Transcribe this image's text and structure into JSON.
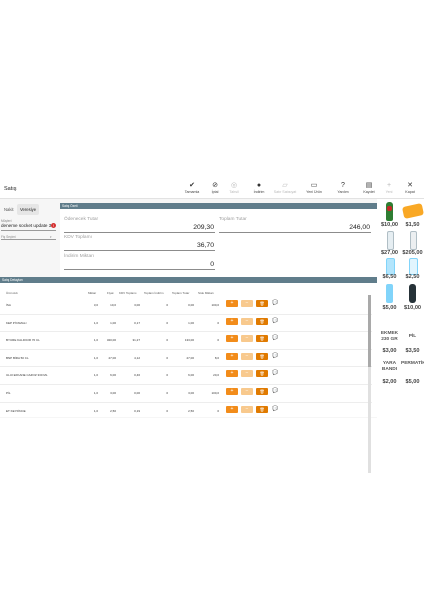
{
  "header": {
    "title": "Satış"
  },
  "toolbar": [
    {
      "name": "tamamla",
      "icon": "✔",
      "label": "Tamamla",
      "enabled": true
    },
    {
      "name": "iptal",
      "icon": "⊘",
      "label": "İptal",
      "enabled": true
    },
    {
      "name": "tahsil",
      "icon": "◎",
      "label": "Tahsil",
      "enabled": false
    },
    {
      "name": "indirim",
      "icon": "●",
      "label": "İndirim",
      "enabled": true
    },
    {
      "name": "satir-satisiyat",
      "icon": "▱",
      "label": "Satır Satısıyat",
      "enabled": false
    },
    {
      "name": "yeni-urun",
      "icon": "▭",
      "label": "Yeni Ürün",
      "enabled": true
    },
    {
      "name": "yardim",
      "icon": "?",
      "label": "Yardım",
      "enabled": true
    },
    {
      "name": "kaydet",
      "icon": "▤",
      "label": "Kaydet",
      "enabled": true
    },
    {
      "name": "yeni",
      "icon": "+",
      "label": "Yeni",
      "enabled": false
    },
    {
      "name": "kapat",
      "icon": "✕",
      "label": "Kapat",
      "enabled": true
    }
  ],
  "tabs": [
    {
      "label": "Nakit"
    },
    {
      "label": "Veresiye"
    }
  ],
  "customer": {
    "label": "Müşteri",
    "value": "deneme socket update 3",
    "error_icon": "!"
  },
  "sale_type": {
    "label": "Satış Tipi",
    "placeholder": "Fiş Seçimi"
  },
  "summary": {
    "header": "Satış Özeti",
    "odenecek_label": "Ödenecek Tutar",
    "odenecek_value": "209,30",
    "toplam_label": "Toplam Tutar",
    "toplam_value": "246,00",
    "kdv_label": "KDV Toplamı",
    "kdv_value": "36,70",
    "indirim_label": "İndirim Miktarı",
    "indirim_value": "0"
  },
  "details": {
    "header": "Satış Detayları",
    "columns": [
      "Ürün Adı",
      "Miktar",
      "Fiyat",
      "KDV Toplamı",
      "Toplam İndirim",
      "Toplam Tutar",
      "Stok Miktarı"
    ],
    "rows": [
      {
        "name": "İSA",
        "qty": "3,0",
        "price": "10,0",
        "kdv": "3,00",
        "disc": "0",
        "total": "0,00",
        "stock": "100,0"
      },
      {
        "name": "KEP PİYAMALI",
        "qty": "1,0",
        "price": "1,00",
        "kdv": "0,17",
        "disc": "0",
        "total": "1,00",
        "stock": "0"
      },
      {
        "name": "BYURE KALDICIR 70 CL",
        "qty": "1,0",
        "price": "320,00",
        "kdv": "31,27",
        "disc": "0",
        "total": "133,00",
        "stock": "0"
      },
      {
        "name": "BNP BİRA 50 CL",
        "qty": "1,0",
        "price": "27,00",
        "kdv": "4,12",
        "disc": "0",
        "total": "27,00",
        "stock": "8,0"
      },
      {
        "name": "ULUI EFKANE CAZOZ 330 ML",
        "qty": "1,0",
        "price": "6,00",
        "kdv": "0,46",
        "disc": "0",
        "total": "6,00",
        "stock": "20,0"
      },
      {
        "name": "PİL",
        "qty": "1,0",
        "price": "3,00",
        "kdv": "0,00",
        "disc": "0",
        "total": "3,00",
        "stock": "100,0"
      },
      {
        "name": "ET KEYFİNCE",
        "qty": "1,0",
        "price": "2,50",
        "kdv": "0,19",
        "disc": "0",
        "total": "2,50",
        "stock": "0"
      }
    ],
    "row_buttons": {
      "plus": "+",
      "minus": "−",
      "delete": "🗑",
      "note": "💬"
    }
  },
  "products": [
    {
      "price": "$10,00",
      "sub": ""
    },
    {
      "price": "$1,50",
      "sub": ""
    },
    {
      "price": "$27,00",
      "sub": ""
    },
    {
      "price": "$205,00",
      "sub": ""
    },
    {
      "price": "$6,50",
      "sub": ""
    },
    {
      "price": "$2,50",
      "sub": ""
    },
    {
      "price": "$5,00",
      "sub": ""
    },
    {
      "price": "$10,00",
      "sub": ""
    },
    {
      "name": "EKMEK 230 GR",
      "price": "$3,00"
    },
    {
      "name": "PİL",
      "price": "$3,50"
    },
    {
      "name": "YARA BANDI",
      "price": "$2,00"
    },
    {
      "name": "PERMATİK",
      "price": "$5,00"
    }
  ]
}
